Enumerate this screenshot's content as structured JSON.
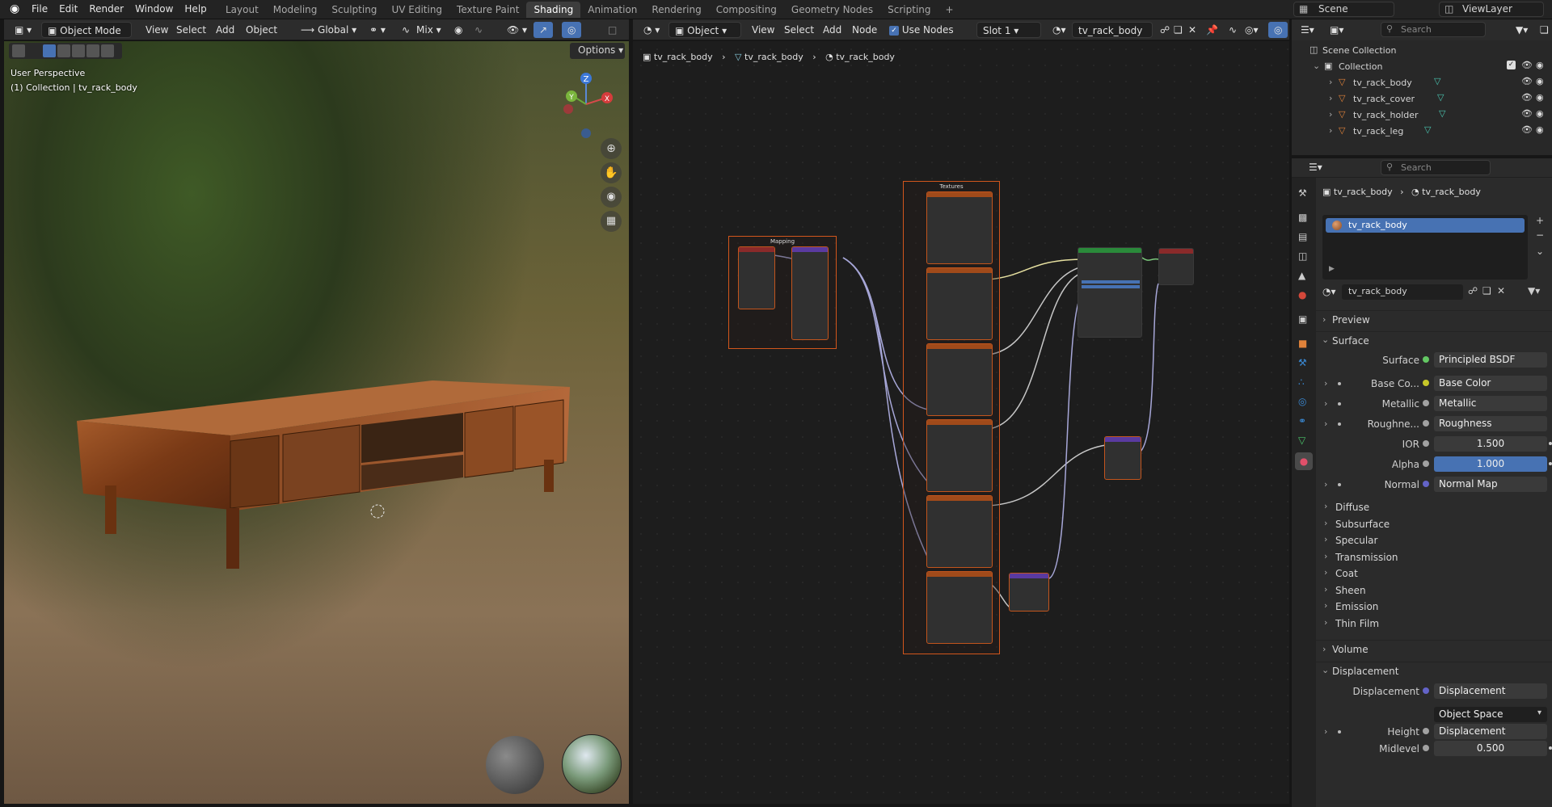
{
  "topbar": {
    "menus": [
      "File",
      "Edit",
      "Render",
      "Window",
      "Help"
    ],
    "workspaces": [
      "Layout",
      "Modeling",
      "Sculpting",
      "UV Editing",
      "Texture Paint",
      "Shading",
      "Animation",
      "Rendering",
      "Compositing",
      "Geometry Nodes",
      "Scripting"
    ],
    "active_workspace": "Shading",
    "add_tab": "+",
    "scene": "Scene",
    "view_layer": "ViewLayer"
  },
  "viewport": {
    "mode": "Object Mode",
    "menus": [
      "View",
      "Select",
      "Add",
      "Object"
    ],
    "transform": "Global",
    "blend": "Mix",
    "options": "Options",
    "info_line1": "User Perspective",
    "info_line2": "(1) Collection | tv_rack_body",
    "gizmo": {
      "z": "Z",
      "y": "Y",
      "x": "X"
    }
  },
  "node_editor": {
    "type": "Object",
    "menus": [
      "View",
      "Select",
      "Add",
      "Node"
    ],
    "use_nodes": "Use Nodes",
    "slot": "Slot 1",
    "material": "tv_rack_body",
    "breadcrumb": [
      "tv_rack_body",
      "tv_rack_body",
      "tv_rack_body"
    ],
    "frames": {
      "mapping": "Mapping",
      "textures": "Textures"
    }
  },
  "outliner": {
    "search_placeholder": "Search",
    "root": "Scene Collection",
    "collection": "Collection",
    "objects": [
      "tv_rack_body",
      "tv_rack_cover",
      "tv_rack_holder",
      "tv_rack_leg"
    ]
  },
  "properties": {
    "search_placeholder": "Search",
    "breadcrumb": [
      "tv_rack_body",
      "tv_rack_body"
    ],
    "slot_item": "tv_rack_body",
    "material_name": "tv_rack_body",
    "sections": {
      "preview": "Preview",
      "surface": "Surface",
      "volume": "Volume",
      "displacement": "Displacement"
    },
    "surface_rows": [
      {
        "label": "Surface",
        "value": "Principled BSDF",
        "color": "#63c763",
        "expand": false
      },
      {
        "label": "Base Co...",
        "value": "Base Color",
        "color": "#c7c729",
        "expand": true
      },
      {
        "label": "Metallic",
        "value": "Metallic",
        "color": "#a1a1a1",
        "expand": true
      },
      {
        "label": "Roughne...",
        "value": "Roughness",
        "color": "#a1a1a1",
        "expand": true
      },
      {
        "label": "IOR",
        "value": "1.500",
        "color": "#a1a1a1",
        "expand": false,
        "kind": "num"
      },
      {
        "label": "Alpha",
        "value": "1.000",
        "color": "#a1a1a1",
        "expand": false,
        "kind": "blue"
      },
      {
        "label": "Normal",
        "value": "Normal Map",
        "color": "#6363c7",
        "expand": true
      }
    ],
    "subpanels": [
      "Diffuse",
      "Subsurface",
      "Specular",
      "Transmission",
      "Coat",
      "Sheen",
      "Emission",
      "Thin Film"
    ],
    "displacement_rows": [
      {
        "label": "Displacement",
        "value": "Displacement",
        "color": "#6363c7"
      },
      {
        "label": "",
        "value": "Object Space",
        "color": ""
      },
      {
        "label": "Height",
        "value": "Displacement",
        "color": "#a1a1a1"
      },
      {
        "label": "Midlevel",
        "value": "0.500",
        "color": "#a1a1a1"
      }
    ]
  },
  "colors": {
    "accent": "#4772b3",
    "frame": "#d2561c",
    "header": "#2b2b2b",
    "bg": "#1d1d1d"
  }
}
